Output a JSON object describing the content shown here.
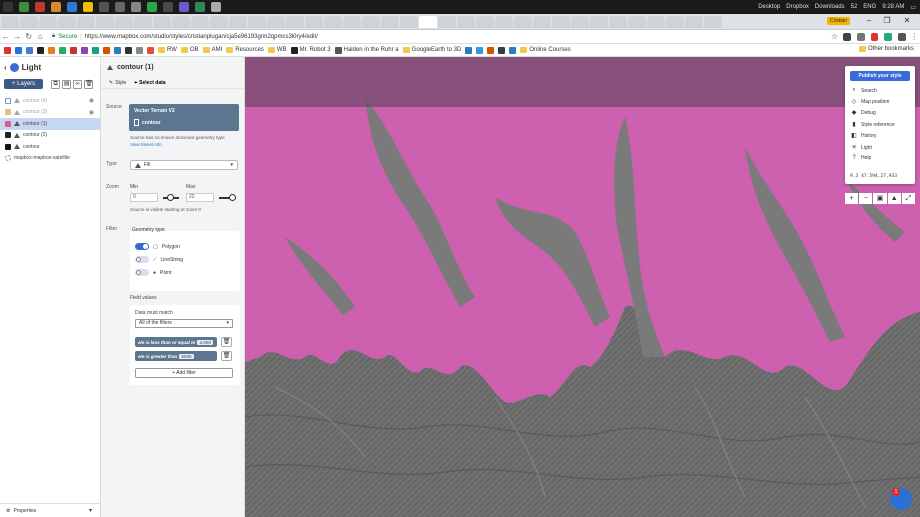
{
  "taskbar": {
    "desktop": "Desktop",
    "dropbox": "Dropbox",
    "downloads": "Downloads",
    "battery": "52",
    "lang": "ENG",
    "time": "9:28 AM"
  },
  "browser": {
    "profile": "Cristian",
    "secure": "Secure",
    "url": "https://www.mapbox.com/studio/styles/cristianplugan/cja5e96193gnn2qpmcs3l0ry4/edit/"
  },
  "bookmarks": [
    "RW",
    "OB",
    "AMI",
    "Resources",
    "WB",
    "Mr. Robot 3",
    "Halden in the Ruhr a",
    "GoogleEarth to 3D",
    "Online Courses"
  ],
  "bookmarks_other": "Other bookmarks",
  "sidebar": {
    "style_name": "Light",
    "layers_label": "+ Layers",
    "layers": [
      {
        "name": "contour (4)",
        "color": "#7c8fd0",
        "muted": true
      },
      {
        "name": "contour (3)",
        "color": "#e8c07a",
        "muted": true
      },
      {
        "name": "contour (1)",
        "color": "#e05a8c",
        "muted": false
      },
      {
        "name": "contour (2)",
        "color": "#222222",
        "muted": false
      },
      {
        "name": "contour",
        "color": "#111111",
        "muted": false
      },
      {
        "name": "mapbox-mapbox-satellite",
        "color": "#cccccc",
        "muted": false
      }
    ],
    "properties": "Properties"
  },
  "editor": {
    "layer_title": "contour (1)",
    "tab_style": "Style",
    "tab_data": "Select data",
    "source_label": "Source",
    "source_title": "Vector Terrain V2",
    "source_layer": "contour",
    "source_note": "Source has no known dominant geometry type",
    "tileset_link": "View tileset info",
    "type_label": "Type",
    "type_value": "Fill",
    "zoom_label": "Zoom",
    "min_label": "Min",
    "max_label": "Max",
    "min_value": "0",
    "max_value": "22",
    "zoom_note": "Source is visible starting at zoom 0",
    "filter_label": "Filter",
    "geometry_type": "Geometry type",
    "geoms": [
      {
        "label": "Polygon",
        "on": true
      },
      {
        "label": "LineString",
        "on": false
      },
      {
        "label": "Point",
        "on": false
      }
    ],
    "field_values": "Field values",
    "data_must_match": "Data must match",
    "match_value": "All of the filters",
    "filters": [
      {
        "text": "ele is less than or equal to",
        "value": "3,000"
      },
      {
        "text": "ele is greater than",
        "value": "6000"
      }
    ],
    "add_filter": "+ Add filter"
  },
  "map_menu": {
    "publish": "Publish your style",
    "items": [
      "Search",
      "Map position",
      "Debug",
      "Style reference",
      "History",
      "Light",
      "Help"
    ],
    "coords": "9.3   47.594,27.933"
  },
  "chat_badge": "1"
}
